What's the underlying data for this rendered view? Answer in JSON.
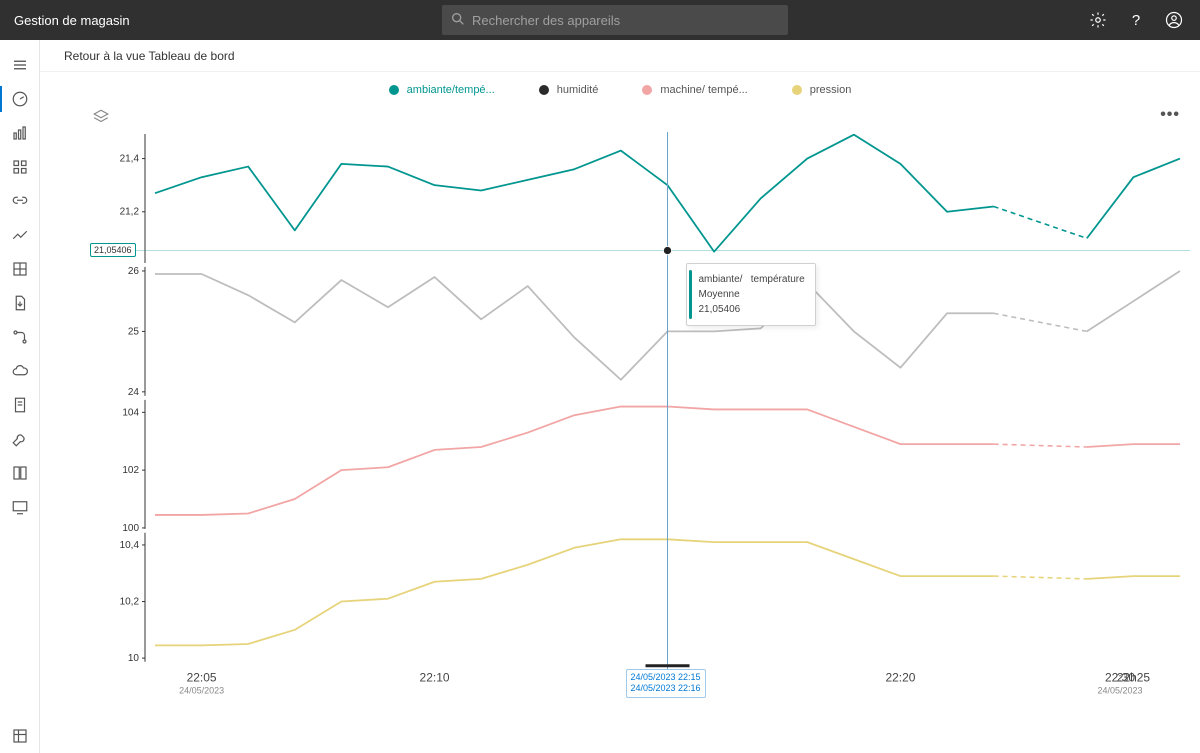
{
  "header": {
    "title": "Gestion de magasin",
    "search_placeholder": "Rechercher des appareils"
  },
  "breadcrumb": "Retour à la vue Tableau de bord",
  "legend": {
    "ambiante": "ambiante/tempé...",
    "humidite": "humidité",
    "machine": "machine/ tempé...",
    "pression": "pression"
  },
  "cursor": {
    "y_label": "21,05406",
    "time1": "24/05/2023 22:15",
    "time2": "24/05/2023 22:16"
  },
  "tooltip": {
    "line1": "ambiante/",
    "line1b": "température",
    "line2": "Moyenne",
    "line3": "21,05406"
  },
  "xaxis": {
    "ticks": [
      "22:05",
      "22:10",
      "22:15",
      "22:20",
      "22h25",
      "22:30"
    ],
    "subdate": "24/05/2023"
  },
  "yaxis": {
    "panel1": [
      "21,4",
      "21,2"
    ],
    "panel2": [
      "26",
      "25",
      "24"
    ],
    "panel3": [
      "104",
      "102",
      "100"
    ],
    "panel4": [
      "10,4",
      "10,2",
      "10"
    ]
  },
  "chart_data": {
    "type": "line",
    "x": [
      "22:04",
      "22:05",
      "22:06",
      "22:07",
      "22:08",
      "22:09",
      "22:10",
      "22:11",
      "22:12",
      "22:13",
      "22:14",
      "22:15",
      "22:16",
      "22:17",
      "22:18",
      "22:19",
      "22:20",
      "22:21",
      "22:22",
      "22:23",
      "22:24",
      "22:25",
      "22:26"
    ],
    "x_cursor_index": 11,
    "series": [
      {
        "name": "ambiante/température",
        "panel": 1,
        "ylim": [
          21.0,
          21.5
        ],
        "yticks": [
          21.2,
          21.4
        ],
        "color": "#00968f",
        "values": [
          21.27,
          21.33,
          21.37,
          21.13,
          21.38,
          21.37,
          21.3,
          21.28,
          21.32,
          21.36,
          21.43,
          21.3,
          21.05,
          21.25,
          21.4,
          21.49,
          21.38,
          21.2,
          21.22,
          21.22,
          21.1,
          21.33,
          21.4
        ],
        "gap_start": 18,
        "gap_end": 20
      },
      {
        "name": "humidité",
        "panel": 2,
        "ylim": [
          23.9,
          26.1
        ],
        "yticks": [
          24,
          25,
          26
        ],
        "color": "#bdbdbd",
        "values": [
          25.95,
          25.95,
          25.6,
          25.15,
          25.85,
          25.4,
          25.9,
          25.2,
          25.75,
          24.9,
          24.2,
          25.0,
          25.0,
          25.05,
          25.8,
          25.0,
          24.4,
          25.3,
          25.3,
          25.3,
          25.0,
          25.5,
          26.0
        ],
        "gap_start": 18,
        "gap_end": 20
      },
      {
        "name": "machine/température",
        "panel": 3,
        "ylim": [
          99.9,
          104.5
        ],
        "yticks": [
          100,
          102,
          104
        ],
        "color": "#f2a5a5",
        "values": [
          100.45,
          100.45,
          100.5,
          101.0,
          102.0,
          102.1,
          102.7,
          102.8,
          103.3,
          103.9,
          104.2,
          104.2,
          104.1,
          104.1,
          104.1,
          103.5,
          102.9,
          102.9,
          102.9,
          102.9,
          102.8,
          102.9,
          102.9
        ],
        "gap_start": 18,
        "gap_end": 20
      },
      {
        "name": "pression",
        "panel": 4,
        "ylim": [
          9.98,
          10.45
        ],
        "yticks": [
          10,
          10.2,
          10.4
        ],
        "color": "#e6d37a",
        "values": [
          10.045,
          10.045,
          10.05,
          10.1,
          10.2,
          10.21,
          10.27,
          10.28,
          10.33,
          10.39,
          10.42,
          10.42,
          10.41,
          10.41,
          10.41,
          10.35,
          10.29,
          10.29,
          10.29,
          10.29,
          10.28,
          10.29,
          10.29
        ],
        "gap_start": 18,
        "gap_end": 20
      }
    ],
    "annotations": {
      "cursor_time": "24/05/2023 22:15 – 22:16",
      "cursor_value_panel1": 21.05406
    }
  }
}
